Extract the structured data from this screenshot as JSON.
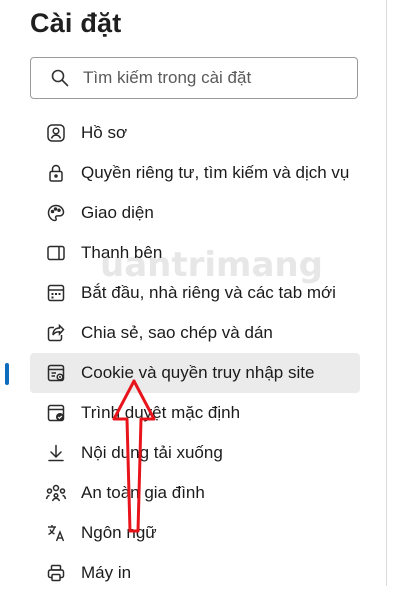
{
  "page_title": "Cài đặt",
  "search": {
    "placeholder": "Tìm kiếm trong cài đặt"
  },
  "menu": [
    {
      "label": "Hồ sơ",
      "icon": "profile-icon"
    },
    {
      "label": "Quyền riêng tư, tìm kiếm và dịch vụ",
      "icon": "lock-icon"
    },
    {
      "label": "Giao diện",
      "icon": "palette-icon"
    },
    {
      "label": "Thanh bên",
      "icon": "sidebar-icon"
    },
    {
      "label": "Bắt đầu, nhà riêng và các tab mới",
      "icon": "start-page-icon"
    },
    {
      "label": "Chia sẻ, sao chép và dán",
      "icon": "share-icon"
    },
    {
      "label": "Cookie và quyền truy nhập site",
      "icon": "cookie-permissions-icon",
      "selected": true
    },
    {
      "label": "Trình duyệt mặc định",
      "icon": "default-browser-icon"
    },
    {
      "label": "Nội dung tải xuống",
      "icon": "download-icon"
    },
    {
      "label": "An toàn gia đình",
      "icon": "family-icon"
    },
    {
      "label": "Ngôn ngữ",
      "icon": "language-icon"
    },
    {
      "label": "Máy in",
      "icon": "printer-icon"
    }
  ],
  "colors": {
    "accent": "#0f6cbd",
    "arrow": "#e8141b",
    "selected_bg": "#ebebeb"
  },
  "watermark": "uantrimang"
}
